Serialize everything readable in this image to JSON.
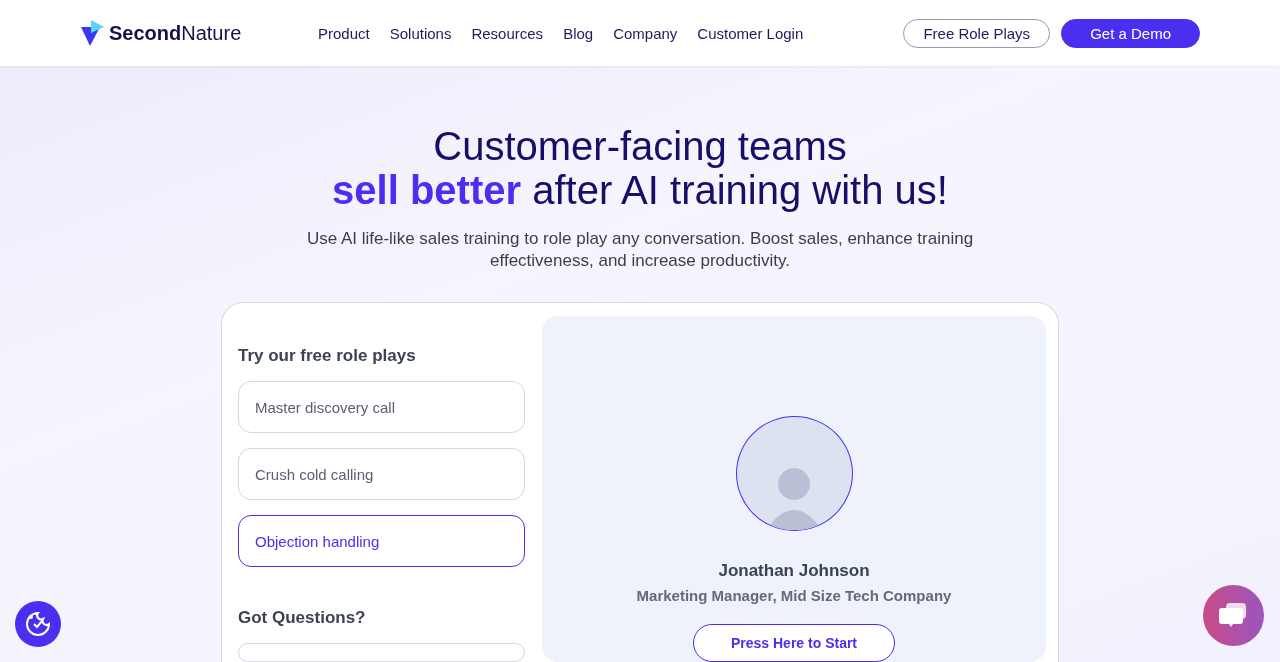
{
  "header": {
    "logo": "**Second**Nature",
    "nav": [
      "Product",
      "Solutions",
      "Resources",
      "Blog",
      "Company",
      "Customer Login"
    ],
    "buttons": [
      {
        "label": "Free Role Plays",
        "kind": "outline"
      },
      {
        "label": "Get a Demo",
        "kind": "filled"
      }
    ]
  },
  "hero": {
    "title_lines": [
      "Customer-facing teams",
      "**sell better** after AI training with us!"
    ],
    "subtitle": "Use AI life-like sales training to role play any conversation. Boost sales, enhance training effectiveness, and increase productivity."
  },
  "card": {
    "heading": "Try our free role plays",
    "options": [
      {
        "label": "Master discovery call",
        "selected": false
      },
      {
        "label": "Crush cold calling",
        "selected": false
      },
      {
        "label": "Objection handling",
        "selected": true
      }
    ],
    "questions_heading": "Got Questions?",
    "persona": {
      "name": "Jonathan Johnson",
      "role": "Marketing Manager, Mid Size Tech Company",
      "button": "Press Here to Start"
    }
  }
}
